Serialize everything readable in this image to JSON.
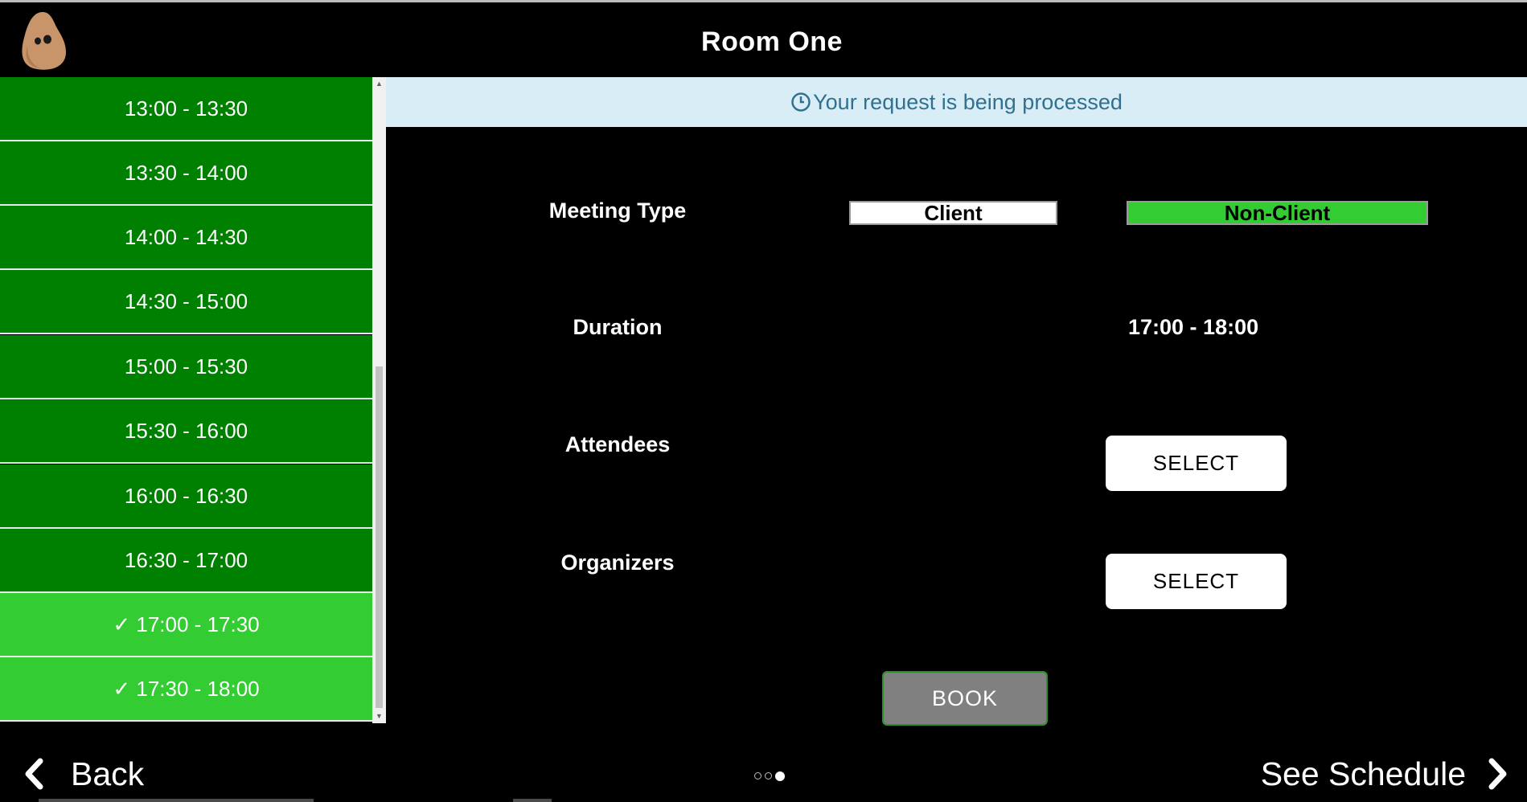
{
  "header": {
    "title": "Room One",
    "logo_icon": "potato-mascot-icon"
  },
  "slots": [
    {
      "label": "13:00 - 13:30",
      "selected": false
    },
    {
      "label": "13:30 - 14:00",
      "selected": false
    },
    {
      "label": "14:00 - 14:30",
      "selected": false
    },
    {
      "label": "14:30 - 15:00",
      "selected": false
    },
    {
      "label": "15:00 - 15:30",
      "selected": false
    },
    {
      "label": "15:30 - 16:00",
      "selected": false
    },
    {
      "label": "16:00 - 16:30",
      "selected": false
    },
    {
      "label": "16:30 - 17:00",
      "selected": false
    },
    {
      "label": "✓ 17:00 - 17:30",
      "selected": true
    },
    {
      "label": "✓ 17:30 - 18:00",
      "selected": true
    }
  ],
  "banner": {
    "text": "Your request is being processed",
    "icon": "clock-icon"
  },
  "form": {
    "meeting_type_label": "Meeting Type",
    "client_label": "Client",
    "nonclient_label": "Non-Client",
    "duration_label": "Duration",
    "duration_value": "17:00 - 18:00",
    "attendees_label": "Attendees",
    "attendees_button": "SELECT",
    "organizers_label": "Organizers",
    "organizers_button": "SELECT",
    "book_button": "BOOK"
  },
  "footer": {
    "back_label": "Back",
    "next_label": "See Schedule",
    "page_count": 3,
    "active_page": 3
  },
  "colors": {
    "slot_green": "#008000",
    "slot_selected": "#33cc33",
    "banner_bg": "#d9edf7",
    "banner_text": "#31708f"
  }
}
